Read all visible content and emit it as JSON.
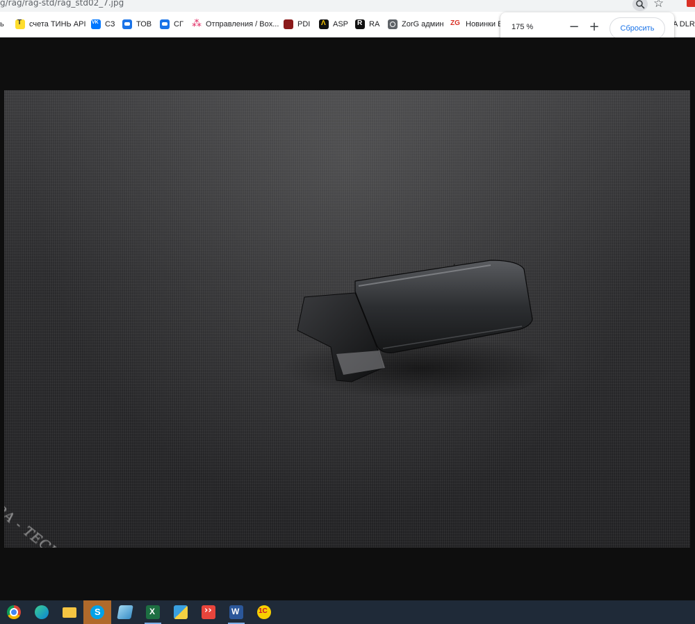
{
  "browser": {
    "url": "g/rag/rag-std/rag_std02_7.jpg"
  },
  "bookmarks": [
    {
      "label": "ь",
      "icon": "none"
    },
    {
      "label": "счета ТИНЬ API",
      "icon": "tinkoff-icon"
    },
    {
      "label": "СЗ",
      "icon": "vk-icon"
    },
    {
      "label": "ТОВ",
      "icon": "message-icon"
    },
    {
      "label": "СГ",
      "icon": "message-icon"
    },
    {
      "label": "Отправления / Box...",
      "icon": "dots-icon"
    },
    {
      "label": "PDI",
      "icon": "pdi-icon"
    },
    {
      "label": "ASP",
      "icon": "asp-icon"
    },
    {
      "label": "RA",
      "icon": "ra-icon"
    },
    {
      "label": "ZorG админ",
      "icon": "globe-icon"
    },
    {
      "label": "Новинки E",
      "icon": "zg-icon"
    },
    {
      "label": "A DLR",
      "icon": "none"
    }
  ],
  "zoom": {
    "level": "175 %",
    "minus": "−",
    "plus": "+",
    "reset": "Сбросить"
  },
  "photo": {
    "watermark": "RA - TECH"
  },
  "taskbar": {
    "apps": [
      "chrome-icon",
      "edge-icon",
      "folder-icon",
      "skype-icon",
      "notes-icon",
      "excel-icon",
      "maps-icon",
      "anydesk-icon",
      "word-icon",
      "1c-icon"
    ],
    "active": "skype-icon"
  },
  "colors": {
    "background": "#0e0e0e",
    "zoom_reset_text": "#1a73e8",
    "taskbar": "#1f2a38",
    "taskbar_active": "#b06a2b"
  }
}
